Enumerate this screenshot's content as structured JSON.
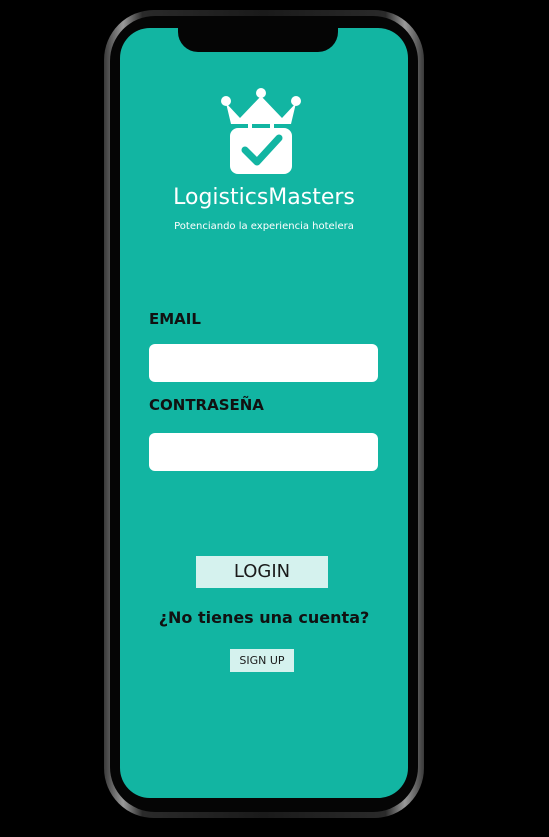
{
  "colors": {
    "screen_background": "#12b5a2",
    "button_background": "#d5f2ee",
    "text_dark": "#111111",
    "text_light": "#ffffff"
  },
  "brand": {
    "name": "LogisticsMasters",
    "tagline": "Potenciando la experiencia hotelera",
    "logo_icon": "crown-briefcase-check-icon"
  },
  "form": {
    "email_label": "EMAIL",
    "email_value": "",
    "email_placeholder": "",
    "password_label": "CONTRASEÑA",
    "password_value": "",
    "password_placeholder": ""
  },
  "actions": {
    "login_label": "LOGIN",
    "no_account_text": "¿No tienes una cuenta?",
    "signup_label": "SIGN UP"
  }
}
